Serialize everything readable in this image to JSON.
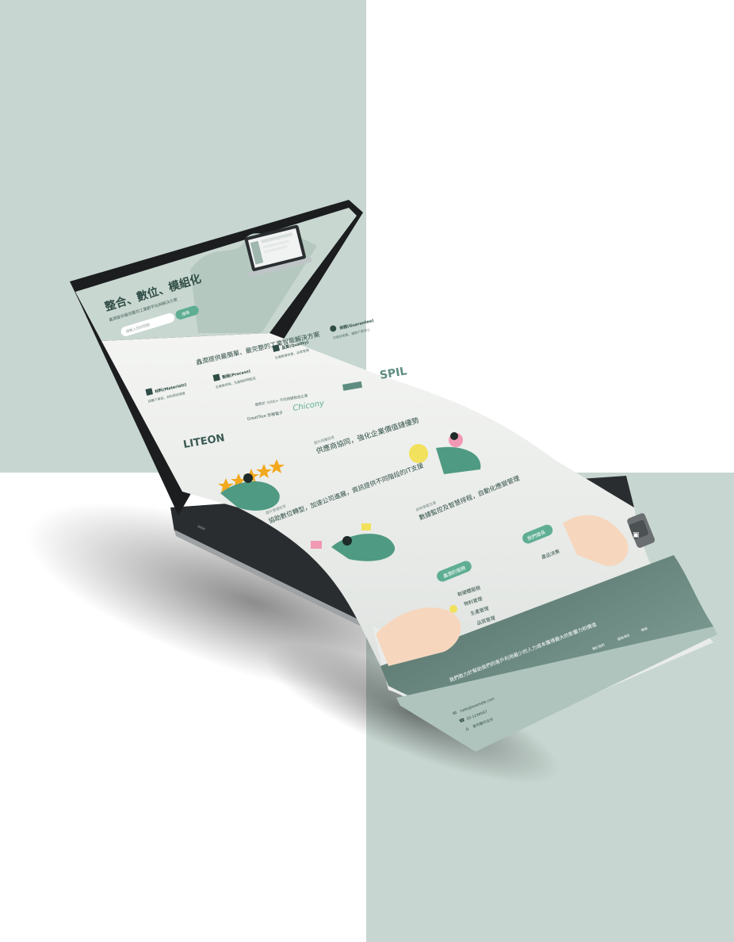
{
  "hero": {
    "title": "整合、數位、模組化",
    "subtitle": "鑫潤提供最完整的工業數字化與解決方案",
    "search_placeholder": "請輸入您的問題",
    "search_button": "搜尋"
  },
  "section_intro": {
    "headline": "鑫潤提供最簡單、最完整的工業智能解決方案"
  },
  "features": [
    {
      "icon": "building-icon",
      "label": "材料(Materials)",
      "desc": "採購下單前，材料提前調度"
    },
    {
      "icon": "process-icon",
      "label": "製程(Process)",
      "desc": "生產線排程，生產線即時監控"
    },
    {
      "icon": "quality-icon",
      "label": "品質(Quality)",
      "desc": "生產數據收集，品質管理"
    },
    {
      "icon": "guarantee-icon",
      "label": "保證(Guarantee)",
      "desc": "交貨前檢驗，讓客戶更安心"
    }
  ],
  "clients": {
    "caption": "服務於 1000+ 不同規模製造企業",
    "logos": [
      "LITEON",
      "GreatTree 巨樹電子",
      "Chicony",
      "SPIL"
    ]
  },
  "sections": [
    {
      "kicker": "提升採購效率",
      "title": "供應商協同，強化企業價值鏈優勢"
    },
    {
      "kicker": "提升管理效率",
      "title": "協助數位轉型，加速公司進展，資訊提供不同階段的IT支援"
    },
    {
      "kicker": "即時掌握生產",
      "title": "數據監控及智慧排程，自動化應變管理"
    }
  ],
  "rating_stars": 5,
  "services": {
    "main_label": "鑫潤的服務",
    "items": [
      "軟硬體服務",
      "物料管理",
      "生產管理",
      "品質管理"
    ],
    "secondary_label": "我們擅長",
    "secondary_items": [
      "產品決策"
    ]
  },
  "footer": {
    "tagline": "我們致力於幫助我們的客戶利用最少的人力成本獲得最大的影響力和價值",
    "columns": [
      "關於我們",
      "服務項目",
      "聯絡"
    ],
    "email": "hello@example.com",
    "phone": "03-1234567",
    "address": "新竹縣竹北市"
  },
  "colors": {
    "background": "#c7d6d0",
    "accent": "#5fae93",
    "dark_green": "#2f4d45",
    "paper": "#f3f4f2",
    "laptop": "#1b1d1f"
  }
}
